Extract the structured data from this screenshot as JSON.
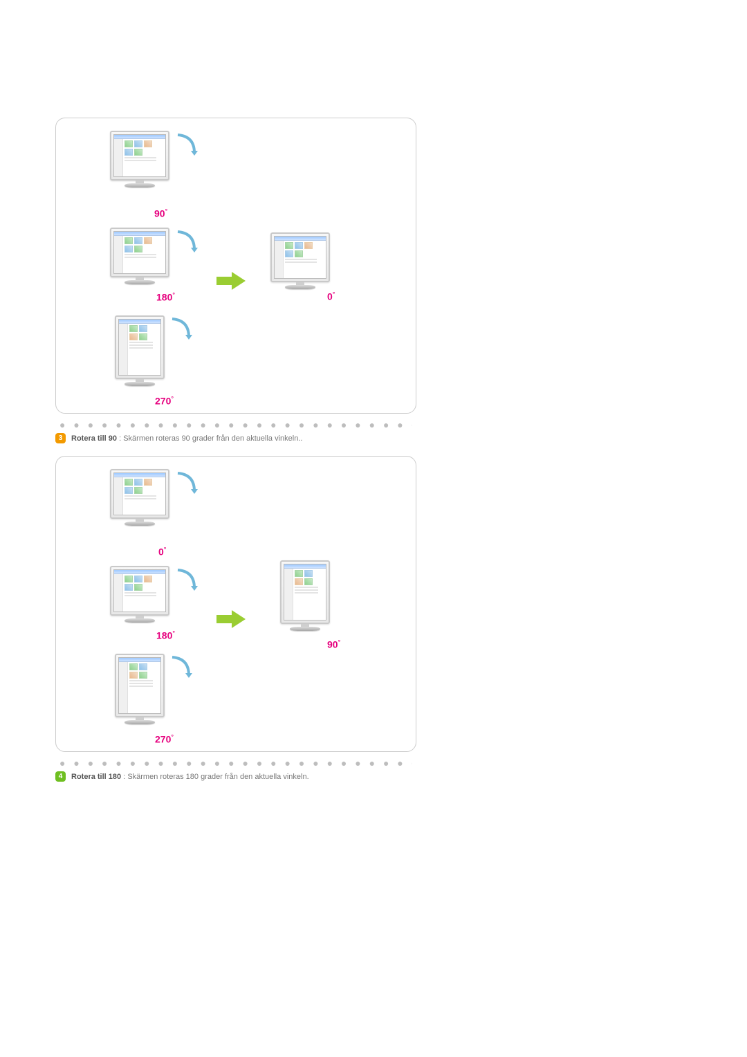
{
  "dots": "● ● ● ● ● ● ● ● ● ● ● ● ● ● ● ● ● ● ● ● ● ● ● ● ● ● ● ● ● ● ● ● ● ● ● ● ● ● ● ● ● ● ● ●",
  "section3": {
    "number": "3",
    "title": "Rotera till 90",
    "sep": " : ",
    "desc": "Skärmen roteras 90 grader från den aktuella vinkeln..",
    "angles": {
      "top": "90",
      "mid": "180",
      "bot": "270",
      "result": "0"
    }
  },
  "section4": {
    "number": "4",
    "title": "Rotera till 180",
    "sep": " : ",
    "desc": "Skärmen roteras 180 grader från den aktuella vinkeln.",
    "angles": {
      "top": "0",
      "mid": "180",
      "bot": "270",
      "result": "90"
    }
  },
  "deg": "°"
}
